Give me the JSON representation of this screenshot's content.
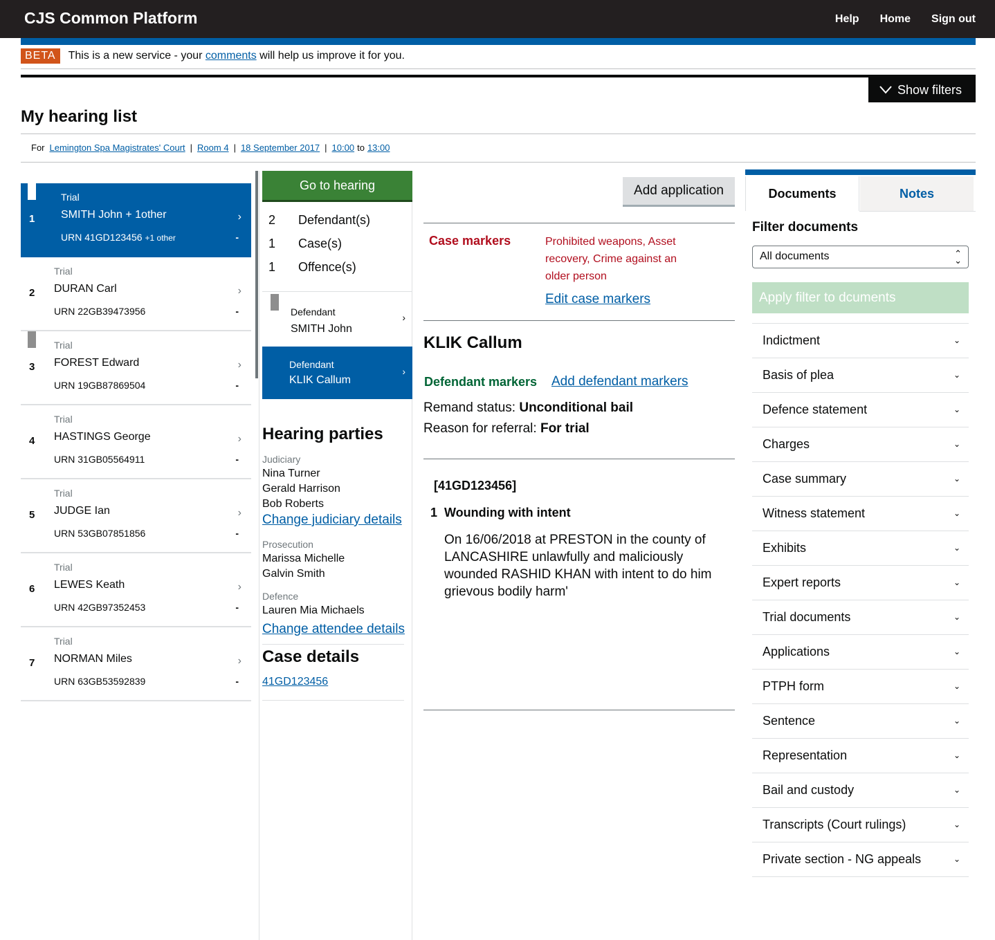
{
  "header": {
    "brand": "CJS Common Platform",
    "nav": [
      "Help",
      "Home",
      "Sign out"
    ]
  },
  "beta": {
    "tag": "BETA",
    "text_before": "This is a new service - your ",
    "link": "comments",
    "text_after": " will help us improve it for you."
  },
  "filters_button": "Show filters",
  "page_title": "My hearing list",
  "context": {
    "for": "For",
    "court": "Lemington Spa Magistrates' Court",
    "sep": "|",
    "room": "Room 4",
    "date": "18 September 2017",
    "from": "10:00",
    "to_word": "to",
    "to": "13:00"
  },
  "hearings": [
    {
      "num": "1",
      "type": "Trial",
      "name": "SMITH John + 1other",
      "urn": "URN 41GD123456",
      "extra": "+1 other",
      "chev": "›",
      "dash": "-"
    },
    {
      "num": "2",
      "type": "Trial",
      "name": "DURAN Carl",
      "urn": "URN 22GB39473956",
      "extra": "",
      "chev": "›",
      "dash": "-"
    },
    {
      "num": "3",
      "type": "Trial",
      "name": "FOREST Edward",
      "urn": "URN 19GB87869504",
      "extra": "",
      "chev": "›",
      "dash": "-"
    },
    {
      "num": "4",
      "type": "Trial",
      "name": "HASTINGS George",
      "urn": "URN 31GB05564911",
      "extra": "",
      "chev": "›",
      "dash": "-"
    },
    {
      "num": "5",
      "type": "Trial",
      "name": "JUDGE Ian",
      "urn": "URN 53GB07851856",
      "extra": "",
      "chev": "›",
      "dash": "-"
    },
    {
      "num": "6",
      "type": "Trial",
      "name": "LEWES Keath",
      "urn": "URN 42GB97352453",
      "extra": "",
      "chev": "›",
      "dash": "-"
    },
    {
      "num": "7",
      "type": "Trial",
      "name": "NORMAN Miles",
      "urn": "URN 63GB53592839",
      "extra": "",
      "chev": "›",
      "dash": "-"
    }
  ],
  "middle": {
    "go_hearing": "Go to hearing",
    "counts": [
      {
        "n": "2",
        "label": "Defendant(s)"
      },
      {
        "n": "1",
        "label": "Case(s)"
      },
      {
        "n": "1",
        "label": "Offence(s)"
      }
    ],
    "defendants": [
      {
        "label": "Defendant",
        "name": "SMITH John",
        "chev": "›"
      },
      {
        "label": "Defendant",
        "name": "KLIK Callum",
        "chev": "›"
      }
    ],
    "parties_title": "Hearing parties",
    "judiciary_label": "Judiciary",
    "judiciary": [
      "Nina Turner",
      "Gerald Harrison",
      "Bob Roberts"
    ],
    "change_judiciary": "Change judiciary details",
    "prosecution_label": "Prosecution",
    "prosecution": [
      "Marissa Michelle",
      "Galvin Smith"
    ],
    "defence_label": "Defence",
    "defence": [
      "Lauren Mia Michaels"
    ],
    "change_attendee": "Change attendee details",
    "case_details_title": "Case details",
    "case_link": "41GD123456"
  },
  "main": {
    "add_application": "Add application",
    "case_markers_label": "Case markers",
    "case_markers_value": "Prohibited weapons, Asset recovery, Crime against an older person",
    "edit_case_markers": "Edit case markers",
    "defendant_name": "KLIK Callum",
    "defendant_markers_label": "Defendant markers",
    "add_defendant_markers": "Add defendant markers",
    "remand_label": "Remand status:",
    "remand_value": "Unconditional bail",
    "referral_label": "Reason for referral:",
    "referral_value": "For trial",
    "case_ref": "[41GD123456]",
    "offence_num": "1",
    "offence_title": "Wounding with intent",
    "offence_desc": "On 16/06/2018 at PRESTON in the county of LANCASHIRE unlawfully and maliciously wounded RASHID KHAN with intent to do him grievous bodily harm'"
  },
  "right": {
    "tabs": [
      "Documents",
      "Notes"
    ],
    "filter_title": "Filter documents",
    "select_value": "All documents",
    "apply_label": "Apply filter to dcuments",
    "documents": [
      "Indictment",
      "Basis of plea",
      "Defence statement",
      "Charges",
      "Case summary",
      "Witness statement",
      "Exhibits",
      "Expert reports",
      "Trial documents",
      "Applications",
      "PTPH form",
      "Sentence",
      "Representation",
      "Bail and custody",
      "Transcripts (Court rulings)",
      "Private section - NG appeals"
    ],
    "doc_chev": "⌄"
  },
  "colors": {
    "header_bg": "#231f20",
    "brand_blue": "#005ea5",
    "beta_orange": "#d1541a",
    "go_green": "#3a8236",
    "marker_red": "#b10e1e",
    "defendant_marker_green": "#006435",
    "apply_disabled": "#bfdfc5"
  }
}
